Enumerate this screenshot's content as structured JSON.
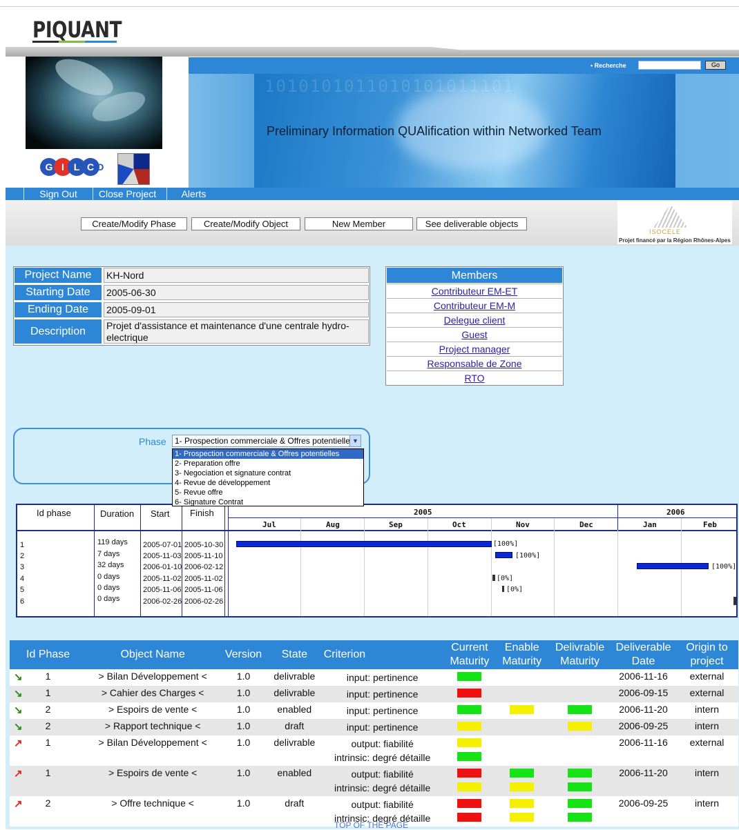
{
  "brand": {
    "name": "PIQUANT",
    "underline_colors": [
      "#2b2b2b",
      "#7cbf43",
      "#2e87d6"
    ]
  },
  "search": {
    "label": "• Recherche",
    "value": "",
    "go_label": "Go"
  },
  "banner": {
    "title": "Preliminary Information QUAlification within Networked Team",
    "bits": "1010101011010101011101"
  },
  "logos": {
    "gilco": [
      "G",
      "I",
      "L",
      "C",
      "O"
    ]
  },
  "menu": {
    "items": [
      "Sign Out",
      "Close Project",
      "Alerts"
    ]
  },
  "toolbar": {
    "buttons": [
      "Create/Modify Phase",
      "Create/Modify Object",
      "New Member",
      "See deliverable objects"
    ]
  },
  "isocele": {
    "name": "ISOCELE",
    "subtitle": "Projet financé par la Région Rhônes-Alpes"
  },
  "project": {
    "rows": [
      {
        "label": "Project Name",
        "value": "KH-Nord"
      },
      {
        "label": "Starting Date",
        "value": "2005-06-30"
      },
      {
        "label": "Ending Date",
        "value": "2005-09-01"
      },
      {
        "label": "Description",
        "value": "Projet d'assistance et maintenance d'une centrale hydro-electrique"
      }
    ]
  },
  "members": {
    "title": "Members",
    "items": [
      "Contributeur EM-ET",
      "Contributeur EM-M",
      "Delegue client",
      "Guest",
      "Project manager",
      "Responsable de Zone",
      "RTO"
    ]
  },
  "phase": {
    "label": "Phase",
    "selected": "1- Prospection commerciale & Offres potentielles",
    "options": [
      "1- Prospection commerciale & Offres potentielles",
      "2- Preparation offre",
      "3- Negociation et signature contrat",
      "4- Revue de développement",
      "5- Revue offre",
      "6- Signature Contrat"
    ]
  },
  "gantt": {
    "headers": {
      "id": "Id phase",
      "duration": "Duration",
      "start": "Start",
      "finish": "Finish"
    },
    "years": [
      "2005",
      "2006"
    ],
    "months": [
      "Jul",
      "Aug",
      "Sep",
      "Oct",
      "Nov",
      "Dec",
      "Jan",
      "Feb"
    ],
    "rows": [
      {
        "id": "1",
        "duration": "119 days",
        "start": "2005-07-01",
        "finish": "2005-10-30",
        "pct": "[100%]",
        "progress": 1.0
      },
      {
        "id": "2",
        "duration": "7 days",
        "start": "2005-11-03",
        "finish": "2005-11-10",
        "pct": "[100%]",
        "progress": 1.0
      },
      {
        "id": "3",
        "duration": "32 days",
        "start": "2006-01-10",
        "finish": "2006-02-12",
        "pct": "[100%]",
        "progress": 1.0
      },
      {
        "id": "4",
        "duration": "0 days",
        "start": "2005-11-02",
        "finish": "2005-11-02",
        "pct": "[0%]",
        "progress": 0.0
      },
      {
        "id": "5",
        "duration": "0 days",
        "start": "2005-11-06",
        "finish": "2005-11-06",
        "pct": "[0%]",
        "progress": 0.0
      },
      {
        "id": "6",
        "duration": "0 days",
        "start": "2006-02-26",
        "finish": "2006-02-26",
        "pct": "",
        "progress": 0.0
      }
    ]
  },
  "objects": {
    "headers": [
      "Id Phase",
      "Object Name",
      "Version",
      "State",
      "Criterion",
      "Current Maturity",
      "Enable Maturity",
      "Delivrable Maturity",
      "Deliverable Date",
      "Origin to project"
    ],
    "colors": {
      "green": "#16e316",
      "red": "#ee1111",
      "yellow": "#f4f000",
      "input_arrow": "#2f8a1a",
      "output_arrow": "#e0281e"
    },
    "rows": [
      {
        "dir": "input",
        "icon": "down-right-arrow-icon",
        "phase": "1",
        "name": "> Bilan Développement <",
        "version": "1.0",
        "state": "delivrable",
        "criteria": [
          "input: pertinence"
        ],
        "current": [
          "green"
        ],
        "enable": [],
        "delivrable": [],
        "date": "2006-11-16",
        "origin": "external"
      },
      {
        "dir": "input",
        "icon": "down-right-arrow-icon",
        "phase": "1",
        "name": "> Cahier des Charges <",
        "version": "1.0",
        "state": "delivrable",
        "criteria": [
          "input: pertinence"
        ],
        "current": [
          "red"
        ],
        "enable": [],
        "delivrable": [],
        "date": "2006-09-15",
        "origin": "external"
      },
      {
        "dir": "input",
        "icon": "down-right-arrow-icon",
        "phase": "2",
        "name": "> Espoirs de vente <",
        "version": "1.0",
        "state": "enabled",
        "criteria": [
          "input: pertinence"
        ],
        "current": [
          "green"
        ],
        "enable": [
          "yellow"
        ],
        "delivrable": [
          "green"
        ],
        "date": "2006-11-20",
        "origin": "intern"
      },
      {
        "dir": "input",
        "icon": "down-right-arrow-icon",
        "phase": "2",
        "name": "> Rapport technique <",
        "version": "1.0",
        "state": "draft",
        "criteria": [
          "input: pertinence"
        ],
        "current": [
          "yellow"
        ],
        "enable": [],
        "delivrable": [
          "yellow"
        ],
        "date": "2006-09-25",
        "origin": "intern"
      },
      {
        "dir": "output",
        "icon": "up-right-arrow-icon",
        "phase": "1",
        "name": "> Bilan Développement <",
        "version": "1.0",
        "state": "delivrable",
        "criteria": [
          "output: fiabilité",
          "intrinsic: degré détaille"
        ],
        "current": [
          "yellow",
          "green"
        ],
        "enable": [],
        "delivrable": [],
        "date": "2006-11-16",
        "origin": "external"
      },
      {
        "dir": "output",
        "icon": "up-right-arrow-icon",
        "phase": "1",
        "name": "> Espoirs de vente <",
        "version": "1.0",
        "state": "enabled",
        "criteria": [
          "output: fiabilité",
          "intrinsic: degré détaille"
        ],
        "current": [
          "red",
          "yellow"
        ],
        "enable": [
          "green",
          "yellow"
        ],
        "delivrable": [
          "green",
          "green"
        ],
        "date": "2006-11-20",
        "origin": "intern"
      },
      {
        "dir": "output",
        "icon": "up-right-arrow-icon",
        "phase": "2",
        "name": "> Offre technique <",
        "version": "1.0",
        "state": "draft",
        "criteria": [
          "output: fiabilité",
          "intrinsic: degré détaille"
        ],
        "current": [
          "red",
          "red"
        ],
        "enable": [
          "yellow",
          "yellow"
        ],
        "delivrable": [
          "green",
          "green"
        ],
        "date": "2006-09-25",
        "origin": "intern"
      }
    ]
  },
  "footer": {
    "top_link": "TOP OF THE PAGE"
  }
}
